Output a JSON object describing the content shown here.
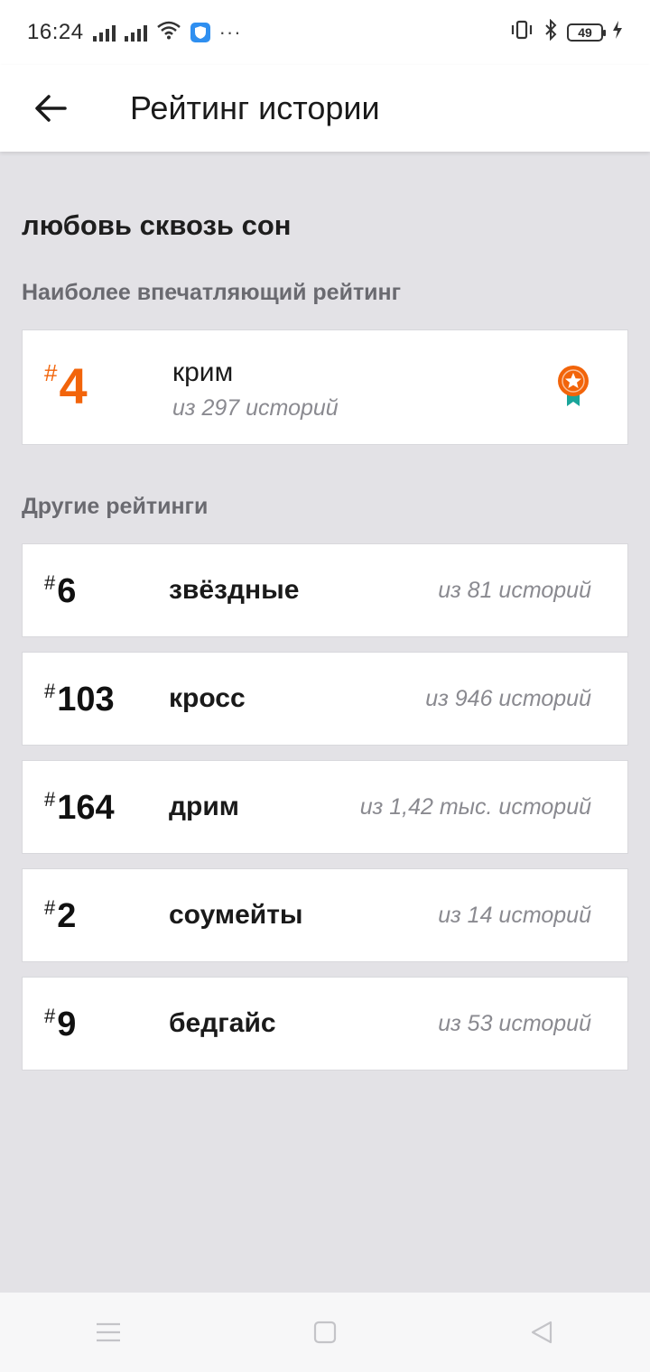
{
  "status": {
    "time": "16:24",
    "battery": "49"
  },
  "header": {
    "title": "Рейтинг истории"
  },
  "story": {
    "title": "любовь сквозь сон"
  },
  "best": {
    "section_label": "Наиболее впечатляющий рейтинг",
    "hash": "#",
    "rank": "4",
    "name": "крим",
    "of": "из 297 историй",
    "accent": "#f2640a"
  },
  "others": {
    "section_label": "Другие рейтинги",
    "items": [
      {
        "hash": "#",
        "rank": "6",
        "name": "звёздные",
        "of": "из 81 историй"
      },
      {
        "hash": "#",
        "rank": "103",
        "name": "кросс",
        "of": "из 946 историй"
      },
      {
        "hash": "#",
        "rank": "164",
        "name": "дрим",
        "of": "из 1,42 тыс. историй"
      },
      {
        "hash": "#",
        "rank": "2",
        "name": "соумейты",
        "of": "из 14 историй"
      },
      {
        "hash": "#",
        "rank": "9",
        "name": "бедгайс",
        "of": "из 53 историй"
      }
    ]
  },
  "icons": {
    "back": "arrow-left-icon",
    "medal": "medal-star-icon",
    "nav_menu": "menu-icon",
    "nav_home": "square-home-icon",
    "nav_back": "triangle-back-icon"
  }
}
